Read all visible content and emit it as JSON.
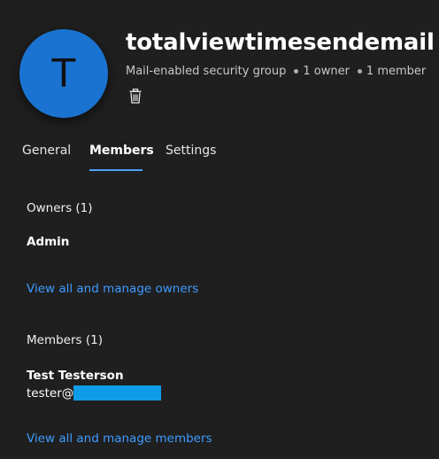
{
  "group": {
    "avatar_letter": "T",
    "name": "totalviewtimesendemail",
    "type": "Mail-enabled security group",
    "owner_count_text": "1 owner",
    "member_count_text": "1 member"
  },
  "tabs": [
    {
      "label": "General",
      "active": false
    },
    {
      "label": "Members",
      "active": true
    },
    {
      "label": "Settings",
      "active": false
    }
  ],
  "owners": {
    "heading": "Owners (1)",
    "items": [
      {
        "name": "Admin"
      }
    ],
    "manage_link": "View all and manage owners"
  },
  "members": {
    "heading": "Members (1)",
    "items": [
      {
        "name": "Test Testerson",
        "email_prefix": "tester@"
      }
    ],
    "manage_link": "View all and manage members"
  },
  "icons": {
    "delete": "trash-icon"
  },
  "colors": {
    "background": "#1f1f1f",
    "avatar": "#1a73d1",
    "accent": "#4aa3ff",
    "link": "#3d9bff",
    "redaction": "#0e9be8"
  }
}
